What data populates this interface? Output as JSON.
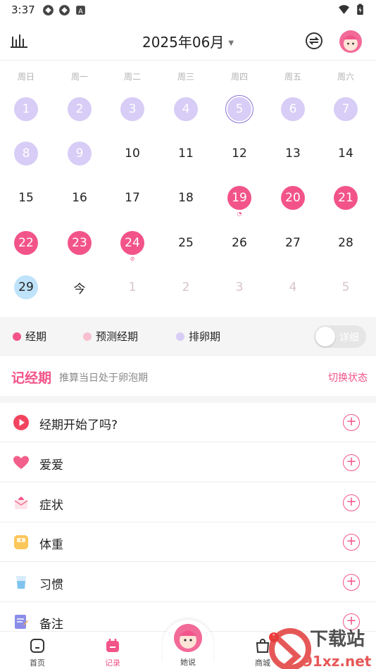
{
  "status_bar": {
    "time": "3:37",
    "icons_left": [
      "sync-icon",
      "sync-icon",
      "notification-a-icon"
    ],
    "icons_right": [
      "wifi-icon",
      "battery-charging-icon"
    ]
  },
  "header": {
    "month": "2025年06月",
    "left_icon": "statistics-icon",
    "right_icons": [
      "sync-toggle-icon",
      "avatar"
    ]
  },
  "calendar": {
    "weekdays": [
      "周日",
      "周一",
      "周二",
      "周三",
      "周四",
      "周五",
      "周六"
    ],
    "rows": [
      [
        "1",
        "2",
        "3",
        "4",
        "5",
        "6",
        "7"
      ],
      [
        "8",
        "9",
        "10",
        "11",
        "12",
        "13",
        "14"
      ],
      [
        "15",
        "16",
        "17",
        "18",
        "19",
        "20",
        "21"
      ],
      [
        "22",
        "23",
        "24",
        "25",
        "26",
        "27",
        "28"
      ],
      [
        "29",
        "今",
        "1",
        "2",
        "3",
        "4",
        "5"
      ]
    ],
    "ovulation_days": [
      "1",
      "2",
      "3",
      "4",
      "5",
      "6",
      "7",
      "8",
      "9"
    ],
    "ovulation_today_marker": "5",
    "period_days": [
      "19",
      "20",
      "21",
      "22",
      "23",
      "24"
    ],
    "selected_day": "29",
    "today_label": "今",
    "next_month_days": [
      "1",
      "2",
      "3",
      "4",
      "5"
    ]
  },
  "legend": {
    "items": [
      {
        "label": "经期",
        "color": "#f2548a"
      },
      {
        "label": "预测经期",
        "color": "#f8c0cf"
      },
      {
        "label": "排卵期",
        "color": "#d7cdf6"
      }
    ],
    "toggle_label": "详细",
    "toggle_on": false
  },
  "record": {
    "title": "记经期",
    "subtitle": "推算当日处于卵泡期",
    "switch_label": "切换状态"
  },
  "list": [
    {
      "label": "经期开始了吗?",
      "icon": "play-icon"
    },
    {
      "label": "爱爱",
      "icon": "heart-icon"
    },
    {
      "label": "症状",
      "icon": "envelope-icon"
    },
    {
      "label": "体重",
      "icon": "scale-icon"
    },
    {
      "label": "习惯",
      "icon": "water-cup-icon"
    },
    {
      "label": "备注",
      "icon": "note-icon"
    }
  ],
  "bottom_nav": {
    "items": [
      {
        "label": "首页",
        "icon": "home-icon",
        "active": false
      },
      {
        "label": "记录",
        "icon": "calendar-icon",
        "active": true
      },
      {
        "label": "她说",
        "icon": "avatar-icon",
        "active": false
      },
      {
        "label": "商城",
        "icon": "shop-bag-icon",
        "active": false,
        "badge": "1"
      }
    ]
  },
  "watermark": {
    "text_top": "下载站",
    "text_bottom": "91xz.net"
  }
}
